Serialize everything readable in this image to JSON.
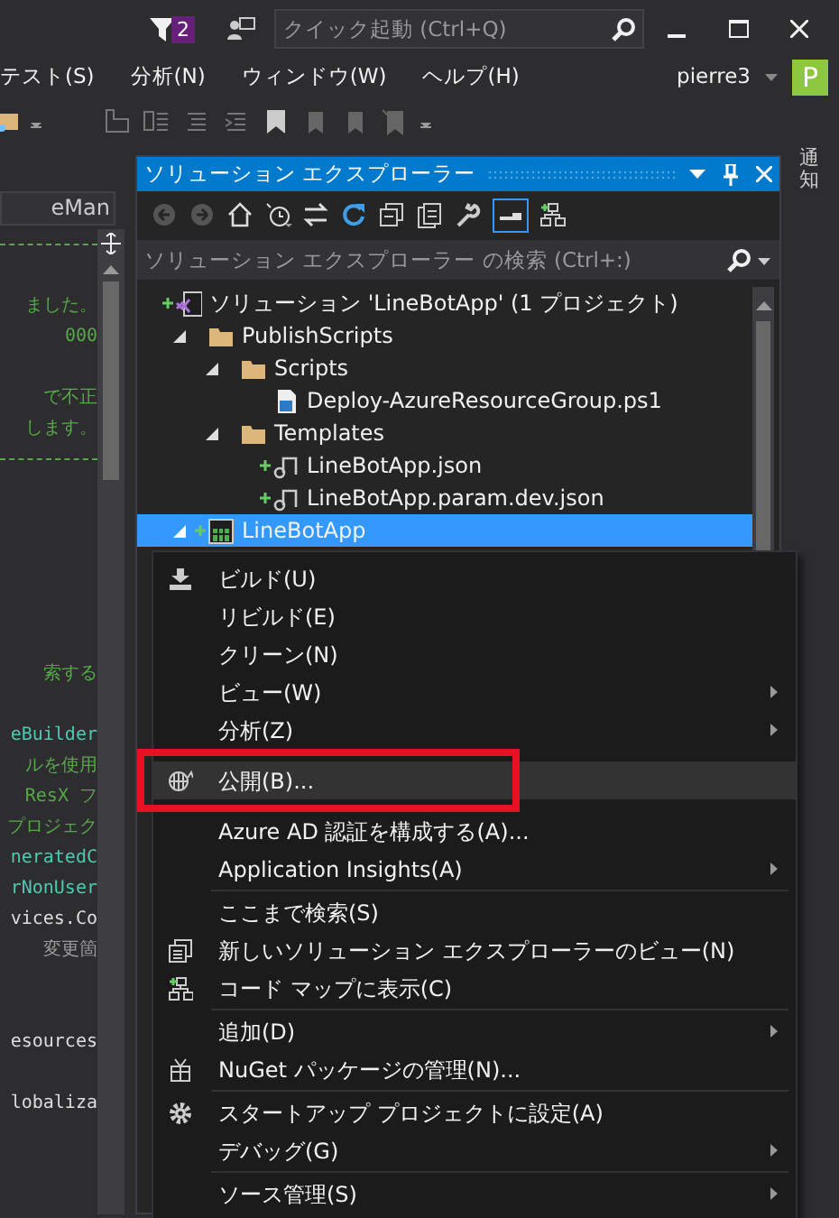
{
  "title_bar": {
    "notification_count": "2",
    "quick_launch": {
      "placeholder": "クイック起動 (Ctrl+Q)"
    }
  },
  "menu_bar": {
    "items": [
      "テスト(S)",
      "分析(N)",
      "ウィンドウ(W)",
      "ヘルプ(H)"
    ],
    "user": "pierre3",
    "avatar": "P"
  },
  "editor": {
    "dropdown": "eMan",
    "lines": [
      {
        "kind": "separator"
      },
      {
        "kind": "blank"
      },
      {
        "kind": "comment",
        "text": "ました。"
      },
      {
        "kind": "comment",
        "text": "000"
      },
      {
        "kind": "blank"
      },
      {
        "kind": "comment",
        "text": "で不正"
      },
      {
        "kind": "comment",
        "text": "します。"
      },
      {
        "kind": "separator"
      },
      {
        "kind": "blank"
      },
      {
        "kind": "blank"
      },
      {
        "kind": "blank"
      },
      {
        "kind": "blank"
      },
      {
        "kind": "blank"
      },
      {
        "kind": "blank"
      },
      {
        "kind": "comment",
        "text": "索する"
      },
      {
        "kind": "blank"
      },
      {
        "kind": "type",
        "text": "eBuilder"
      },
      {
        "kind": "comment",
        "text": "ルを使用"
      },
      {
        "kind": "comment",
        "text": "ResX フ"
      },
      {
        "kind": "comment",
        "text": "プロジェク"
      },
      {
        "kind": "type",
        "text": "neratedC"
      },
      {
        "kind": "type",
        "text": "rNonUser"
      },
      {
        "kind": "plain",
        "text": "vices.Co"
      },
      {
        "kind": "gray",
        "text": "変更箇"
      },
      {
        "kind": "blank"
      },
      {
        "kind": "blank"
      },
      {
        "kind": "plain",
        "text": "esources"
      },
      {
        "kind": "blank"
      },
      {
        "kind": "plain",
        "text": "lobaliza"
      }
    ]
  },
  "side_tab": {
    "label": "通知"
  },
  "solution_explorer": {
    "title": "ソリューション エクスプローラー",
    "search": {
      "placeholder": "ソリューション エクスプローラー の検索 (Ctrl+:)"
    },
    "tree": [
      {
        "label": "ソリューション 'LineBotApp' (1 プロジェクト)",
        "kind": "solution",
        "pending_add": true,
        "selected": false,
        "children": [
          {
            "label": "PublishScripts",
            "kind": "folder",
            "pending_add": false,
            "selected": false,
            "expanded": true,
            "children": [
              {
                "label": "Scripts",
                "kind": "folder",
                "pending_add": false,
                "selected": false,
                "expanded": true,
                "children": [
                  {
                    "label": "Deploy-AzureResourceGroup.ps1",
                    "kind": "script",
                    "pending_add": false,
                    "selected": false
                  }
                ]
              },
              {
                "label": "Templates",
                "kind": "folder",
                "pending_add": false,
                "selected": false,
                "expanded": true,
                "children": [
                  {
                    "label": "LineBotApp.json",
                    "kind": "json",
                    "pending_add": true,
                    "selected": false
                  },
                  {
                    "label": "LineBotApp.param.dev.json",
                    "kind": "json",
                    "pending_add": true,
                    "selected": false
                  }
                ]
              }
            ]
          },
          {
            "label": "LineBotApp",
            "kind": "project",
            "pending_add": true,
            "selected": true,
            "expanded": true
          }
        ]
      }
    ]
  },
  "context_menu": {
    "items": [
      {
        "kind": "build",
        "label": "ビルド(U)",
        "submenu": false,
        "selected": false
      },
      {
        "kind": "plain",
        "label": "リビルド(E)",
        "submenu": false,
        "selected": false
      },
      {
        "kind": "plain",
        "label": "クリーン(N)",
        "submenu": false,
        "selected": false
      },
      {
        "kind": "plain",
        "label": "ビュー(W)",
        "submenu": true,
        "selected": false
      },
      {
        "kind": "plain",
        "label": "分析(Z)",
        "submenu": true,
        "selected": false
      },
      {
        "kind": "publish",
        "label": "公開(B)...",
        "submenu": false,
        "selected": true,
        "boxed": true
      },
      {
        "kind": "plain",
        "label": "Azure AD 認証を構成する(A)...",
        "submenu": false,
        "selected": false
      },
      {
        "kind": "plain",
        "label": "Application Insights(A)",
        "submenu": true,
        "selected": false
      },
      {
        "kind": "separator"
      },
      {
        "kind": "plain",
        "label": "ここまで検索(S)",
        "submenu": false,
        "selected": false
      },
      {
        "kind": "new-view",
        "label": "新しいソリューション エクスプローラーのビュー(N)",
        "submenu": false,
        "selected": false
      },
      {
        "kind": "code-map",
        "label": "コード マップに表示(C)",
        "submenu": false,
        "selected": false
      },
      {
        "kind": "separator"
      },
      {
        "kind": "plain",
        "label": "追加(D)",
        "submenu": true,
        "selected": false
      },
      {
        "kind": "nuget",
        "label": "NuGet パッケージの管理(N)...",
        "submenu": false,
        "selected": false
      },
      {
        "kind": "separator"
      },
      {
        "kind": "settings",
        "label": "スタートアップ プロジェクトに設定(A)",
        "submenu": false,
        "selected": false
      },
      {
        "kind": "plain",
        "label": "デバッグ(G)",
        "submenu": true,
        "selected": false
      },
      {
        "kind": "separator"
      },
      {
        "kind": "plain",
        "label": "ソース管理(S)",
        "submenu": true,
        "selected": false
      }
    ]
  }
}
